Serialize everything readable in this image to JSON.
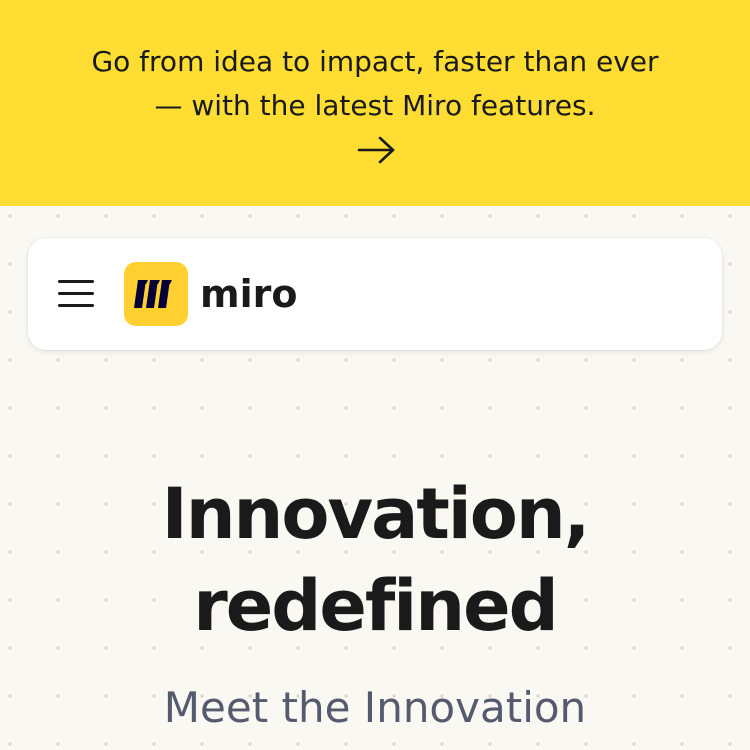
{
  "banner": {
    "text": "Go from idea to impact, faster than ever — with the latest Miro features.",
    "arrow_icon": "arrow-right-icon",
    "background": "#ffdd33"
  },
  "nav": {
    "menu_icon": "hamburger-menu-icon",
    "logo": {
      "wordmark": "miro",
      "mark_color": "#ffd02f"
    }
  },
  "hero": {
    "title_line1": "Innovation,",
    "title_line2": "redefined",
    "subtitle": "Meet the Innovation"
  }
}
